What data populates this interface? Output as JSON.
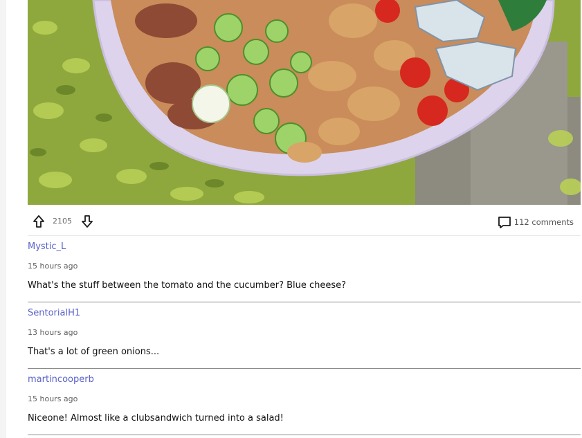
{
  "post": {
    "image_alt": "Bowl of salad with bacon, green onions, chicken, tomatoes, cucumber and blue cheese on a ground cover background",
    "upvote_icon": "arrow-up-outline-icon",
    "downvote_icon": "arrow-down-outline-icon",
    "score": "2105",
    "comment_icon": "speech-bubble-icon",
    "comments_label": "112 comments"
  },
  "comments": [
    {
      "author": "Mystic_L",
      "time": "15 hours ago",
      "body": "What's the stuff between the tomato and the cucumber? Blue cheese?"
    },
    {
      "author": "SentorialH1",
      "time": "13 hours ago",
      "body": "That's a lot of green onions..."
    },
    {
      "author": "martincooperb",
      "time": "15 hours ago",
      "body": "Niceone! Almost like a clubsandwich turned into a salad!"
    }
  ],
  "colors": {
    "author_link": "#5a63c9",
    "divider": "#8a8a8a",
    "bowl": "#e4dcf2",
    "grass": "#9bb34a"
  }
}
